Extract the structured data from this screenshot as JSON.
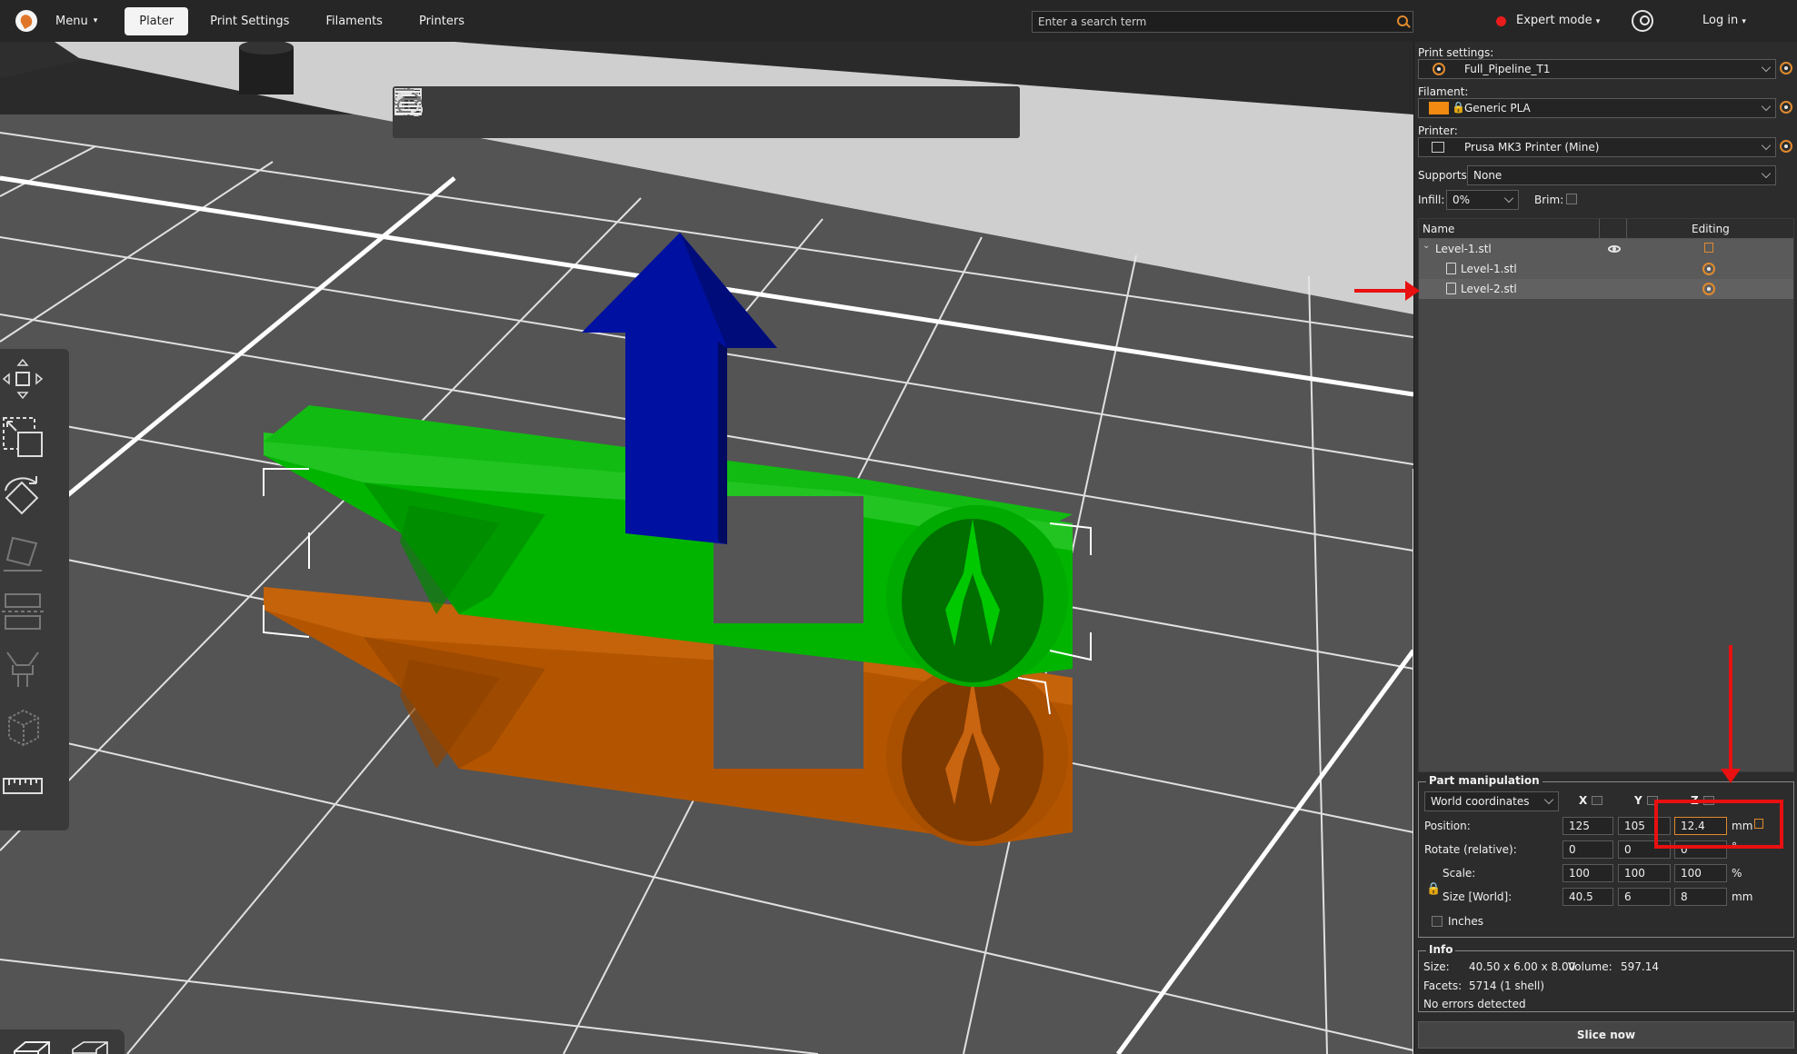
{
  "topbar": {
    "menu_label": "Menu",
    "tabs": [
      "Plater",
      "Print Settings",
      "Filaments",
      "Printers"
    ],
    "active_tab": "Plater",
    "search_placeholder": "Enter a search term",
    "mode_label": "Expert mode",
    "mode_color": "#e81c1c",
    "login_label": "Log in"
  },
  "settings": {
    "print_label": "Print settings:",
    "print_value": "Full_Pipeline_T1",
    "filament_label": "Filament:",
    "filament_value": "Generic PLA",
    "filament_color": "#f08a10",
    "printer_label": "Printer:",
    "printer_value": "Prusa MK3 Printer (Mine)",
    "supports_label": "Supports:",
    "supports_value": "None",
    "infill_label": "Infill:",
    "infill_value": "0%",
    "brim_label": "Brim:",
    "brim_checked": false
  },
  "object_list": {
    "col_name": "Name",
    "col_editing": "Editing",
    "items": [
      {
        "label": "Level-1.stl",
        "level": 0
      },
      {
        "label": "Level-1.stl",
        "level": 1
      },
      {
        "label": "Level-2.stl",
        "level": 1
      }
    ]
  },
  "part_manipulation": {
    "title": "Part manipulation",
    "coord_system": "World coordinates",
    "axis_x": "X",
    "axis_y": "Y",
    "axis_z": "Z",
    "position_label": "Position:",
    "position": [
      "125",
      "105",
      "12.4"
    ],
    "position_unit": "mm",
    "rotate_label": "Rotate (relative):",
    "rotate": [
      "0",
      "0",
      "0"
    ],
    "rotate_unit": "°",
    "scale_label": "Scale:",
    "scale": [
      "100",
      "100",
      "100"
    ],
    "scale_unit": "%",
    "size_label": "Size [World]:",
    "size": [
      "40.5",
      "6",
      "8"
    ],
    "size_unit": "mm",
    "inches_label": "Inches"
  },
  "info": {
    "title": "Info",
    "size_label": "Size:",
    "size_value": "40.50 x 6.00 x 8.00",
    "volume_label": "Volume:",
    "volume_value": "597.14",
    "facets_label": "Facets:",
    "facets_value": "5714 (1 shell)",
    "errors": "No errors detected"
  },
  "slice_button": "Slice now",
  "colors": {
    "accent": "#e08a2e",
    "part_green": "#00b000",
    "part_orange": "#b85a00",
    "arrow_blue": "#0010a0",
    "annotation_red": "#e81010"
  }
}
